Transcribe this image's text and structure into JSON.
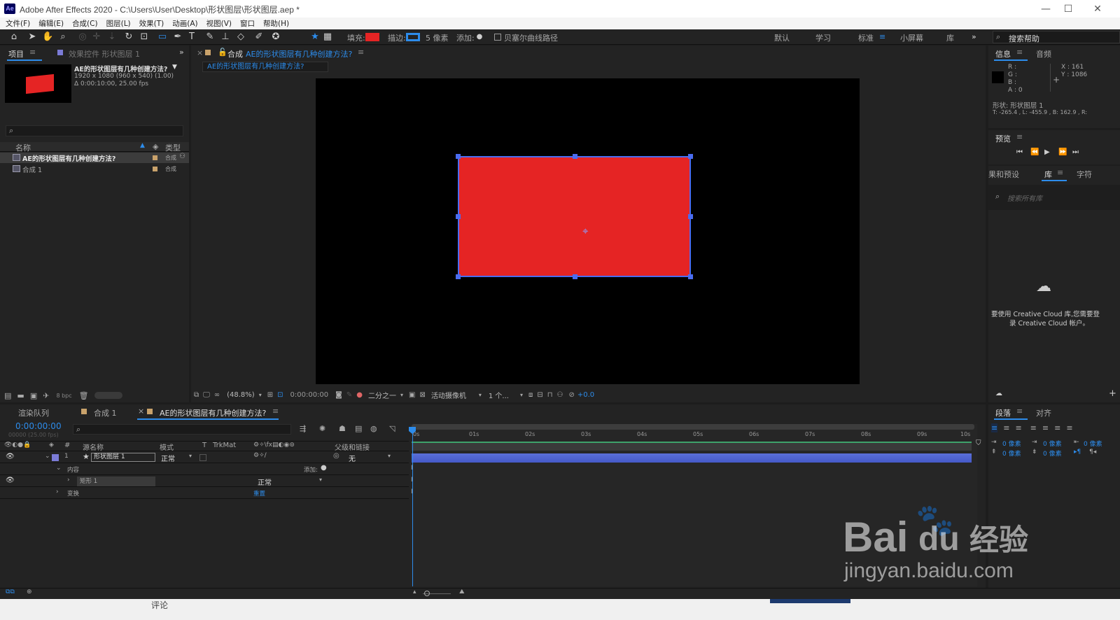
{
  "titlebar": {
    "app_badge": "Ae",
    "title": "Adobe After Effects 2020 - C:\\Users\\User\\Desktop\\形状图层\\形状图层.aep *",
    "minimize": "—",
    "maximize": "☐",
    "close": "✕"
  },
  "menu": [
    "文件(F)",
    "编辑(E)",
    "合成(C)",
    "图层(L)",
    "效果(T)",
    "动画(A)",
    "视图(V)",
    "窗口",
    "帮助(H)"
  ],
  "toolbar": {
    "fill_label": "填充:",
    "stroke_label": "描边:",
    "stroke_size": "5 像素",
    "add_label": "添加:",
    "bezier_label": "贝塞尔曲线路径",
    "fill_color": "#e52424",
    "stroke_color": "#2d8ceb",
    "workspaces": [
      "默认",
      "学习",
      "标准",
      "小屏幕",
      "库"
    ],
    "active_workspace": "标准",
    "search_placeholder": "搜索帮助"
  },
  "project_panel": {
    "tab_project": "项目",
    "tab_effects": "效果控件 形状图层 1",
    "selected_name": "AE的形状图层有几种创建方法?",
    "info_size": "1920 x 1080  (960 x 540) (1.00)",
    "info_duration": "Δ 0:00:10:00, 25.00 fps",
    "col_name": "名称",
    "col_type": "类型",
    "items": [
      {
        "name": "AE的形状图层有几种创建方法?",
        "type": "合成"
      },
      {
        "name": "合成 1",
        "type": "合成"
      }
    ],
    "bpc": "8 bpc"
  },
  "comp_panel": {
    "tab_prefix": "合成",
    "tab_name": "AE的形状图层有几种创建方法?",
    "breadcrumb": "AE的形状图层有几种创建方法?",
    "zoom": "(48.8%)",
    "timecode": "0:00:00:00",
    "resolution": "二分之一",
    "camera": "活动摄像机",
    "views": "1 个...",
    "exposure": "+0.0",
    "shape_color": "#e52424",
    "shape_outline": "#4a6cf0"
  },
  "info_panel": {
    "tab_info": "信息",
    "tab_audio": "音频",
    "r": "R :",
    "g": "G :",
    "b": "B :",
    "a": "A : 0",
    "x": "X : 161",
    "y": "Y : 1086",
    "shape_line": "形状: 形状图层 1",
    "bounds": "T: -265.4 ,  L: -455.9 ,  B: 162.9 ,  R:"
  },
  "preview_panel": {
    "title": "预览"
  },
  "library_panel": {
    "tab_effects": "果和预设",
    "tab_library": "库",
    "tab_char": "字符",
    "search_placeholder": "搜索所有库",
    "msg_line1": "要使用 Creative Cloud 库,您需要登",
    "msg_line2": "录 Creative Cloud 帐户。"
  },
  "timeline": {
    "tab_render": "渲染队列",
    "tab_comp1": "合成 1",
    "tab_main": "AE的形状图层有几种创建方法?",
    "timecode": "0:00:00:00",
    "fps": "00000 (25.00 fps)",
    "col_num": "#",
    "col_source": "源名称",
    "col_mode": "模式",
    "col_t": "T",
    "col_trkmat": "TrkMat",
    "col_parent": "父级和链接",
    "ruler": [
      "0s",
      "01s",
      "02s",
      "03s",
      "04s",
      "05s",
      "06s",
      "07s",
      "08s",
      "09s",
      "10s"
    ],
    "layer": {
      "num": "1",
      "name": "形状图层 1",
      "mode": "正常",
      "parent": "无"
    },
    "content_label": "内容",
    "add_label": "添加:",
    "rect_label": "矩形 1",
    "rect_mode": "正常",
    "transform_label": "变换",
    "reset_label": "重置"
  },
  "paragraph_panel": {
    "tab_para": "段落",
    "tab_align": "对齐",
    "px1": "0 像素",
    "px2": "0 像素",
    "px3": "0 像素",
    "px4": "0 像素",
    "px5": "0 像素"
  },
  "watermark": {
    "brand": "Bai",
    "brand_du": "du",
    "brand_cn": "经验",
    "url": "jingyan.baidu.com"
  },
  "taskbar": {
    "text": "评论"
  }
}
